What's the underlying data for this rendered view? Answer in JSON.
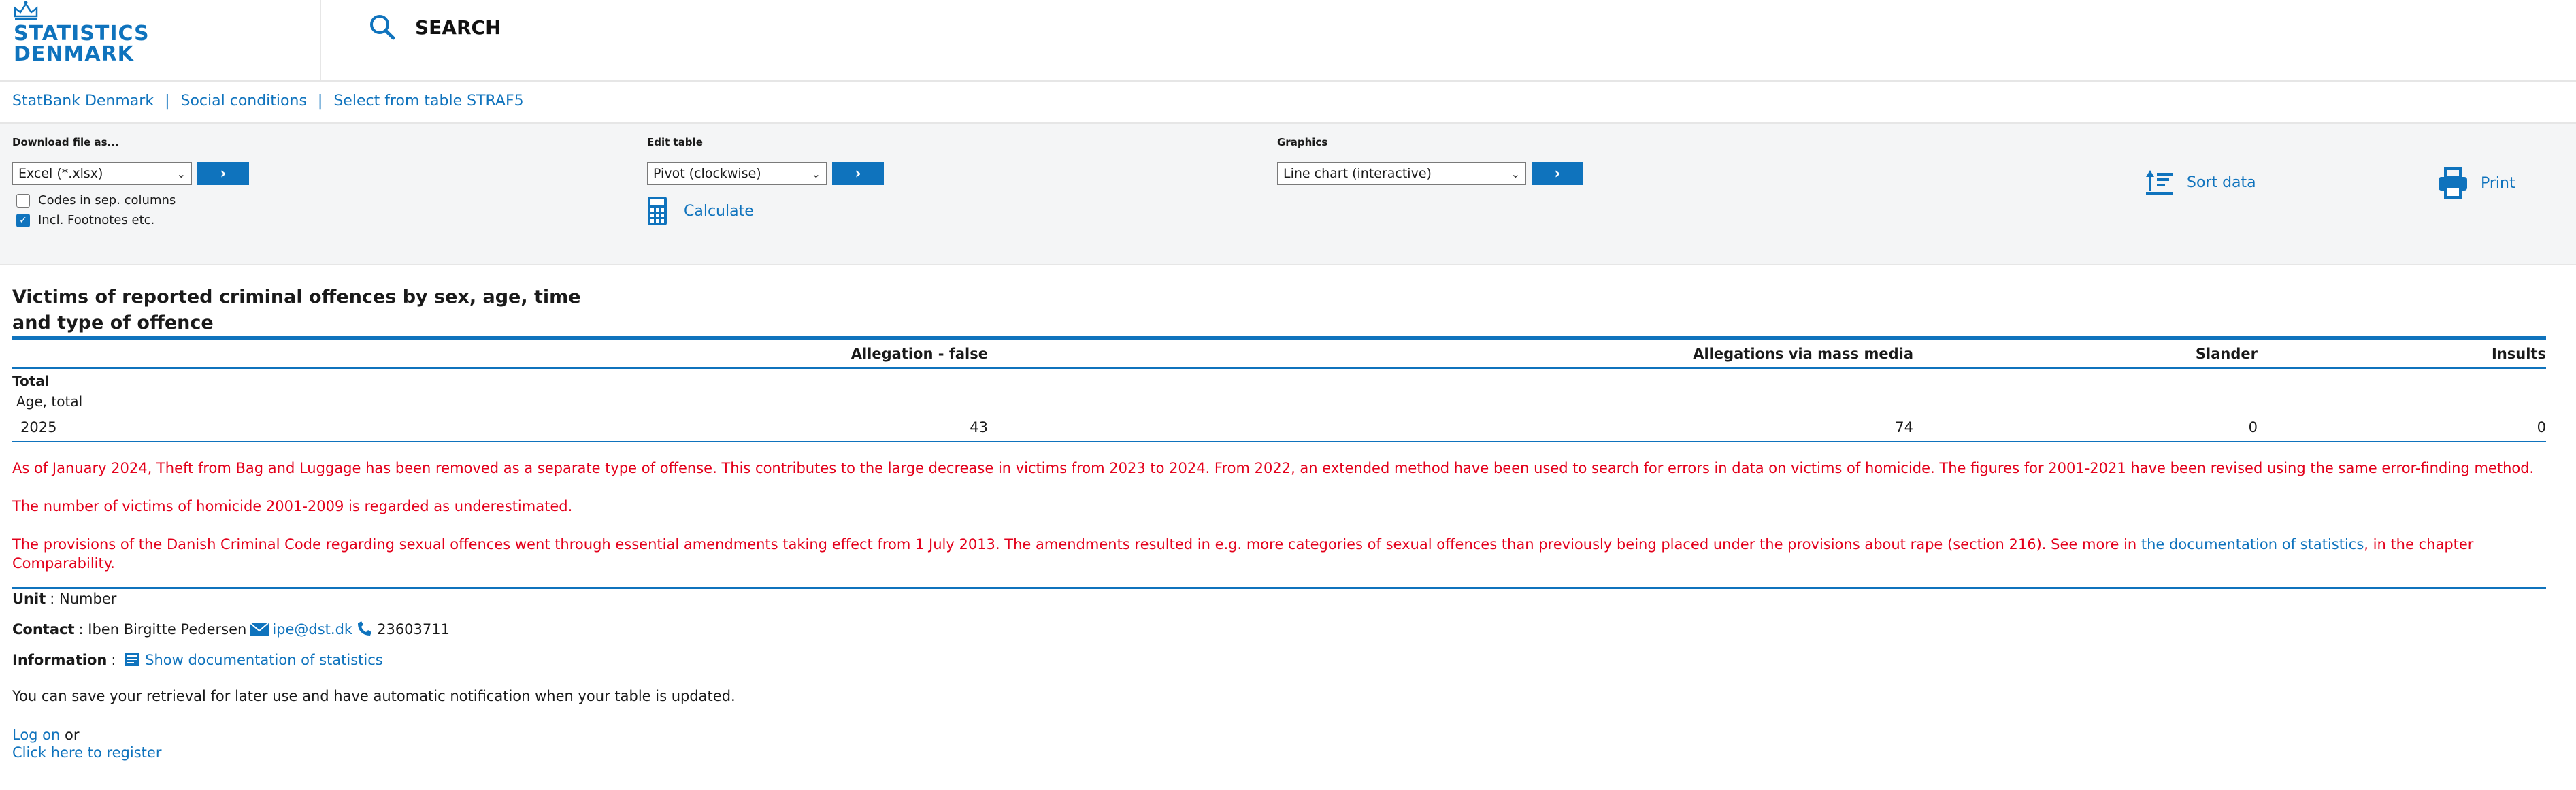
{
  "header": {
    "logo_line1": "STATISTICS",
    "logo_line2": "DENMARK",
    "search_label": "SEARCH"
  },
  "breadcrumb": [
    "StatBank Denmark",
    "Social conditions",
    "Select from table STRAF5"
  ],
  "toolbar": {
    "download": {
      "label": "Download file as...",
      "selected": "Excel (*.xlsx)",
      "go": "›",
      "codes_label": "Codes in sep. columns",
      "codes_checked": false,
      "footnotes_label": "Incl. Footnotes etc.",
      "footnotes_checked": true
    },
    "edit": {
      "label": "Edit table",
      "selected": "Pivot (clockwise)",
      "go": "›",
      "calculate": "Calculate"
    },
    "graphics": {
      "label": "Graphics",
      "selected": "Line chart (interactive)",
      "go": "›"
    },
    "sort_label": "Sort data",
    "print_label": "Print"
  },
  "table": {
    "title": "Victims of reported criminal offences by sex, age, time and type of offence",
    "columns": [
      "Allegation - false",
      "Allegations via mass media",
      "Slander",
      "Insults"
    ],
    "stub_sex": "Total",
    "stub_age": "Age, total",
    "rows": [
      {
        "time": "2025",
        "values": [
          "43",
          "74",
          "0",
          "0"
        ]
      }
    ]
  },
  "notes": {
    "note1": "As of January 2024, Theft from Bag and Luggage has been removed as a separate type of offense. This contributes to the large decrease in victims from 2023 to 2024. From 2022, an extended method have been used to search for errors in data on victims of homicide. The figures for 2001-2021 have been revised using the same error-finding method.",
    "note2": "The number of victims of homicide 2001-2009 is regarded as underestimated.",
    "note3_pre": "The provisions of the Danish Criminal Code regarding sexual offences went through essential amendments taking effect from 1 July 2013. The amendments resulted in e.g. more categories of sexual offences than previously being placed under the provisions about rape (section 216). See more in ",
    "note3_link": "the documentation of statistics",
    "note3_post": ", in the chapter Comparability."
  },
  "info": {
    "unit_label": "Unit",
    "unit_value": "Number",
    "contact_label": "Contact",
    "contact_name": "Iben Birgitte Pedersen",
    "contact_email": "ipe@dst.dk",
    "contact_phone": "23603711",
    "information_label": "Information",
    "information_link": "Show documentation of statistics",
    "save_message": "You can save your retrieval for later use and have automatic notification when your table is updated.",
    "logon_link": "Log on",
    "logon_or": "or",
    "register_link": "Click here to register"
  }
}
